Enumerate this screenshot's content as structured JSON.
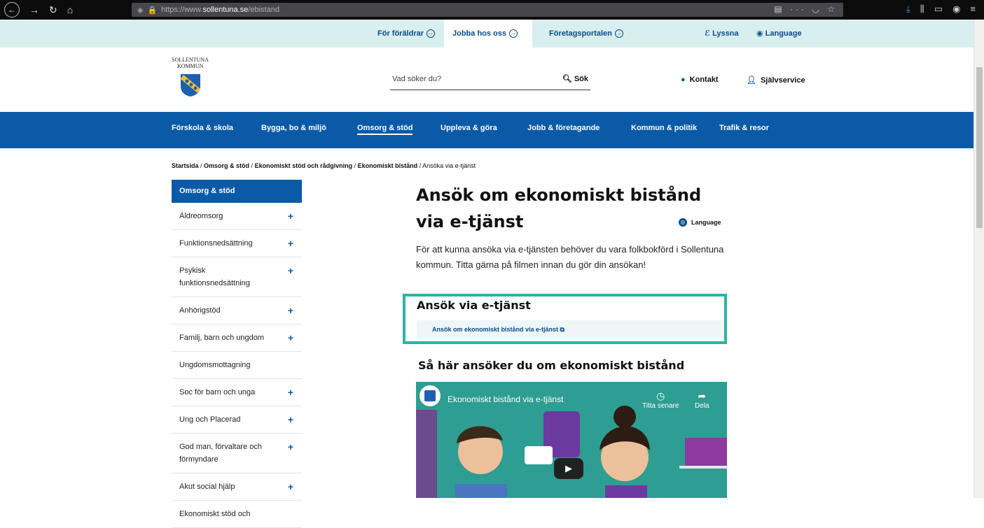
{
  "browser": {
    "url_prefix": "https://www.",
    "url_domain": "sollentuna.se",
    "url_path": "/ebistand",
    "menu_dots": "···"
  },
  "topbar": {
    "items": [
      "För föräldrar",
      "Jobba hos oss",
      "Företagsportalen"
    ],
    "listen": "Lyssna",
    "language": "Language"
  },
  "header": {
    "logo_line1": "SOLLENTUNA",
    "logo_line2": "KOMMUN",
    "search_placeholder": "Vad söker du?",
    "search_button": "Sök",
    "contact": "Kontakt",
    "self_service": "Självservice"
  },
  "mainnav": {
    "items": [
      "Förskola & skola",
      "Bygga, bo & miljö",
      "Omsorg & stöd",
      "Uppleva & göra",
      "Jobb & företagande",
      "Kommun & politik",
      "Trafik & resor"
    ]
  },
  "breadcrumb": {
    "items": [
      "Startsida",
      "Omsorg & stöd",
      "Ekonomiskt stöd och rådgivning",
      "Ekonomiskt bistånd"
    ],
    "current": "Ansöka via e-tjänst"
  },
  "sidebar": {
    "title": "Omsorg & stöd",
    "items": [
      {
        "label": "Äldreomsorg",
        "plus": "+"
      },
      {
        "label": "Funktionsnedsättning",
        "plus": "+"
      },
      {
        "label": "Psykisk funktionsnedsättning",
        "plus": "+"
      },
      {
        "label": "Anhörigstöd",
        "plus": "+"
      },
      {
        "label": "Familj, barn och ungdom",
        "plus": "+"
      },
      {
        "label": "Ungdomsmottagning",
        "plus": ""
      },
      {
        "label": "Soc för barn och unga",
        "plus": "+"
      },
      {
        "label": "Ung och Placerad",
        "plus": "+"
      },
      {
        "label": "God man, förvaltare och förmyndare",
        "plus": "+"
      },
      {
        "label": "Akut social hjälp",
        "plus": "+"
      },
      {
        "label": "Ekonomiskt stöd och",
        "plus": ""
      }
    ]
  },
  "content": {
    "title": "Ansök om ekonomiskt bistånd via e-tjänst",
    "language": "Language",
    "lead": "För att kunna ansöka via e-tjänsten behöver du vara folkbokförd i Sollentuna kommun. Titta gärna på filmen innan du gör din ansökan!",
    "box_title": "Ansök via e-tjänst",
    "box_link": "Ansök om ekonomiskt bistånd via e-tjänst",
    "video_heading": "Så här ansöker du om ekonomiskt bistånd",
    "video_title": "Ekonomiskt bistånd via e-tjänst",
    "watch_later": "Titta senare",
    "share": "Dela"
  }
}
